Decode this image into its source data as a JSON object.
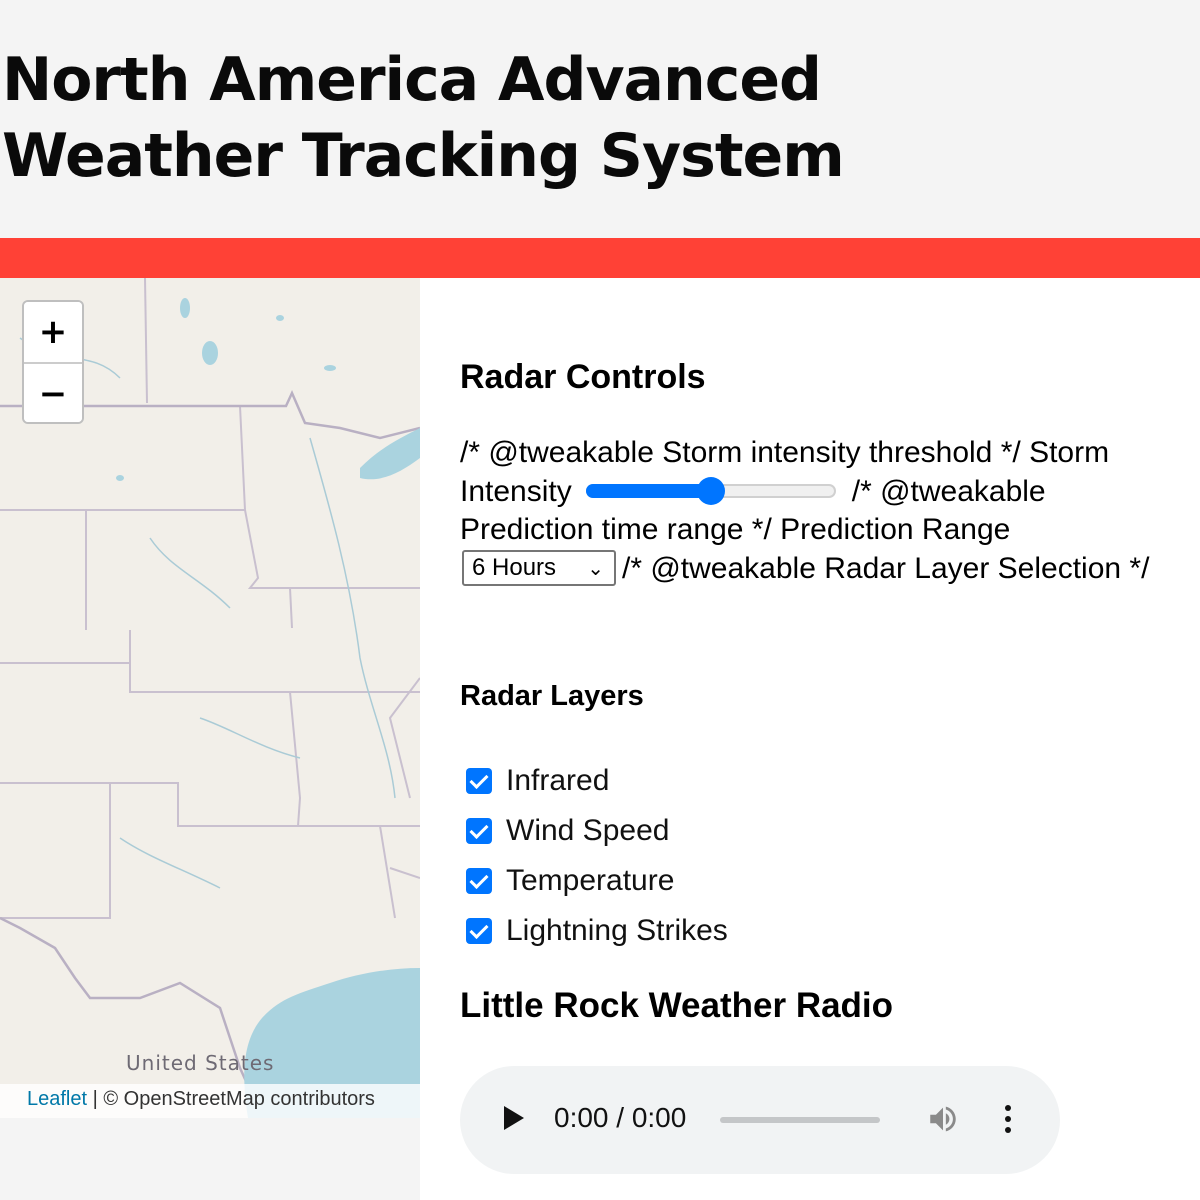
{
  "header": {
    "title": "North America Advanced Weather Tracking System"
  },
  "theme": {
    "accent_bar_color": "#ff4136",
    "control_blue": "#0075ff"
  },
  "map": {
    "zoom_in_label": "+",
    "zoom_out_label": "−",
    "country_label": "United States",
    "attribution_link": "Leaflet",
    "attribution_text": " | © OpenStreetMap contributors"
  },
  "controls": {
    "heading": "Radar Controls",
    "comment_intensity": "/* @tweakable Storm intensity threshold */",
    "storm_intensity_label": "Storm Intensity",
    "storm_intensity_value": 0.5,
    "comment_prediction": "/* @tweakable Prediction time range */",
    "prediction_range_label": "Prediction Range",
    "prediction_range_value": "6 Hours",
    "comment_layer": "/* @tweakable Radar Layer Selection */"
  },
  "layers": {
    "heading": "Radar Layers",
    "items": [
      {
        "label": "Infrared",
        "checked": true
      },
      {
        "label": "Wind Speed",
        "checked": true
      },
      {
        "label": "Temperature",
        "checked": true
      },
      {
        "label": "Lightning Strikes",
        "checked": true
      }
    ]
  },
  "radio": {
    "heading": "Little Rock Weather Radio",
    "time_display": "0:00 / 0:00",
    "play_icon": "play-icon",
    "volume_icon": "volume-icon",
    "more_icon": "more-vertical-icon"
  }
}
